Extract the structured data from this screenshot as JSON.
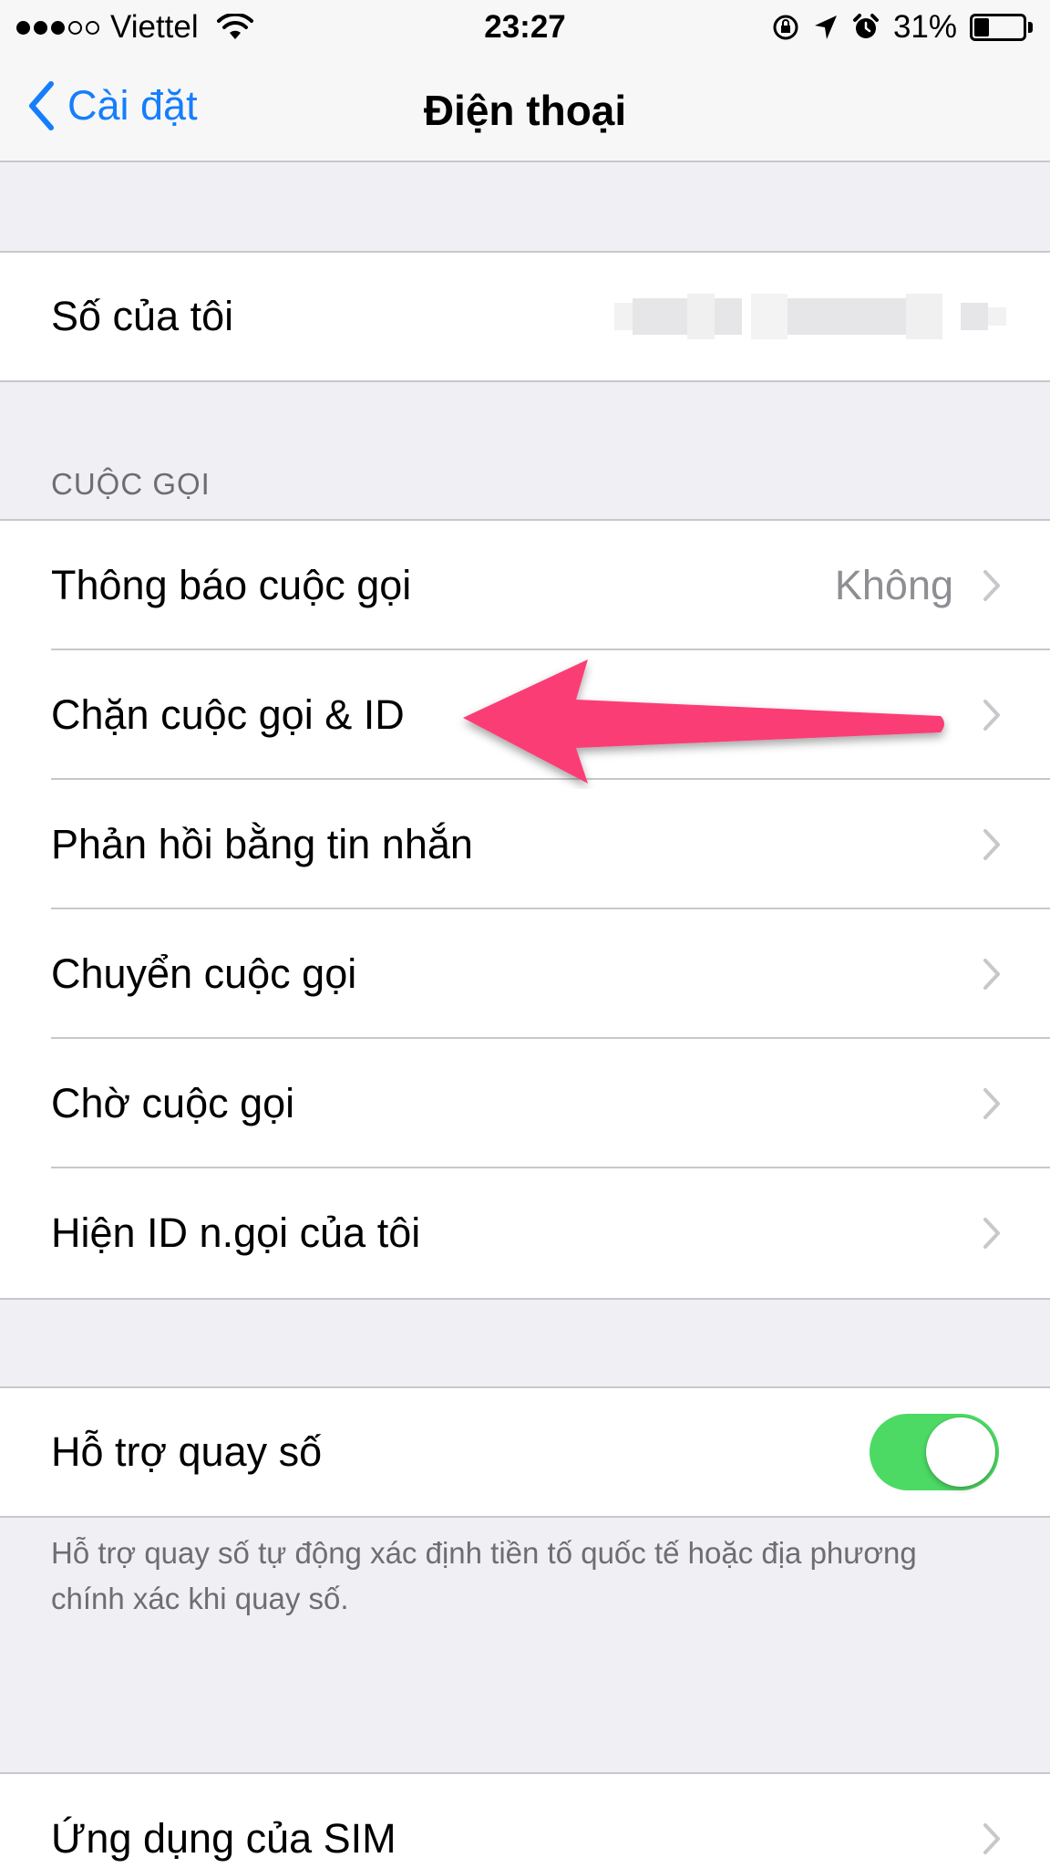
{
  "status_bar": {
    "carrier": "Viettel",
    "time": "23:27",
    "battery": "31%",
    "battery_level": 0.31,
    "signal_bars": 3,
    "signal_max": 5
  },
  "nav": {
    "back_label": "Cài đặt",
    "title": "Điện thoại"
  },
  "my_number": {
    "label": "Số của tôi"
  },
  "calls_section": {
    "header": "CUỘC GỌI",
    "items": [
      {
        "label": "Thông báo cuộc gọi",
        "detail": "Không"
      },
      {
        "label": "Chặn cuộc gọi & ID"
      },
      {
        "label": "Phản hồi bằng tin nhắn"
      },
      {
        "label": "Chuyển cuộc gọi"
      },
      {
        "label": "Chờ cuộc gọi"
      },
      {
        "label": "Hiện ID n.gọi của tôi"
      }
    ]
  },
  "dial_assist": {
    "label": "Hỗ trợ quay số",
    "enabled": true,
    "footer": "Hỗ trợ quay số tự động xác định tiền tố quốc tế hoặc địa phương chính xác khi quay số."
  },
  "sim_apps": {
    "label": "Ứng dụng của SIM"
  },
  "colors": {
    "accent": "#157efb",
    "toggle_on": "#4cd964",
    "arrow": "#fb3d76",
    "background": "#efeff4"
  }
}
